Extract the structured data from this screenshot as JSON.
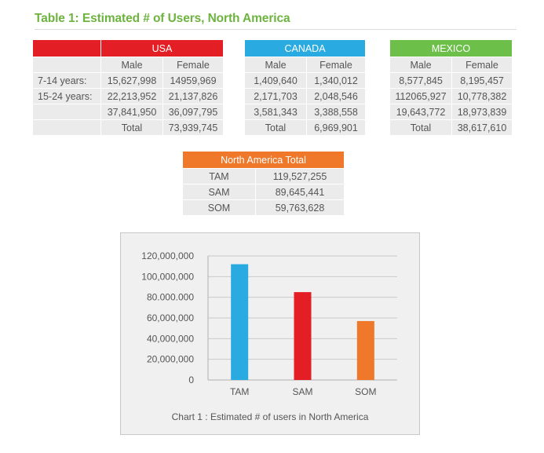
{
  "title": "Table 1: Estimated # of Users, North America",
  "colors": {
    "usa": "#e31e25",
    "canada": "#29abe2",
    "mexico": "#6cc04a",
    "na_total": "#f0782a",
    "title": "#6db33f"
  },
  "country_tables": [
    {
      "key": "usa",
      "name": "USA",
      "col_male": "Male",
      "col_female": "Female",
      "rows": [
        {
          "label": "7-14 years:",
          "male": "15,627,998",
          "female": "14959,969"
        },
        {
          "label": "15-24 years:",
          "male": "22,213,952",
          "female": "21,137,826"
        },
        {
          "label": "",
          "male": "37,841,950",
          "female": "36,097,795"
        },
        {
          "label": "",
          "male": "Total",
          "female": "73,939,745"
        }
      ]
    },
    {
      "key": "canada",
      "name": "CANADA",
      "col_male": "Male",
      "col_female": "Female",
      "rows": [
        {
          "male": "1,409,640",
          "female": "1,340,012"
        },
        {
          "male": "2,171,703",
          "female": "2,048,546"
        },
        {
          "male": "3,581,343",
          "female": "3,388,558"
        },
        {
          "male": "Total",
          "female": "6,969,901"
        }
      ]
    },
    {
      "key": "mexico",
      "name": "MEXICO",
      "col_male": "Male",
      "col_female": "Female",
      "rows": [
        {
          "male": "8,577,845",
          "female": "8,195,457"
        },
        {
          "male": "112065,927",
          "female": "10,778,382"
        },
        {
          "male": "19,643,772",
          "female": "18,973,839"
        },
        {
          "male": "Total",
          "female": "38,617,610"
        }
      ]
    }
  ],
  "na_total": {
    "name": "North America Total",
    "rows": [
      {
        "label": "TAM",
        "value": "119,527,255"
      },
      {
        "label": "SAM",
        "value": "89,645,441"
      },
      {
        "label": "SOM",
        "value": "59,763,628"
      }
    ]
  },
  "chart_data": {
    "type": "bar",
    "categories": [
      "TAM",
      "SAM",
      "SOM"
    ],
    "values": [
      112000000,
      85000000,
      57000000
    ],
    "bar_colors": [
      "#29abe2",
      "#e31e25",
      "#f0782a"
    ],
    "ytick_labels": [
      "0",
      "20,000,000",
      "40,000,000",
      "60,000,000",
      "80.000.000",
      "100,000,000",
      "120,000,000"
    ],
    "ylim": [
      0,
      120000000
    ],
    "grid": true,
    "legend": false,
    "caption": "Chart 1 : Estimated # of users in North America",
    "xlabel": "",
    "ylabel": ""
  }
}
